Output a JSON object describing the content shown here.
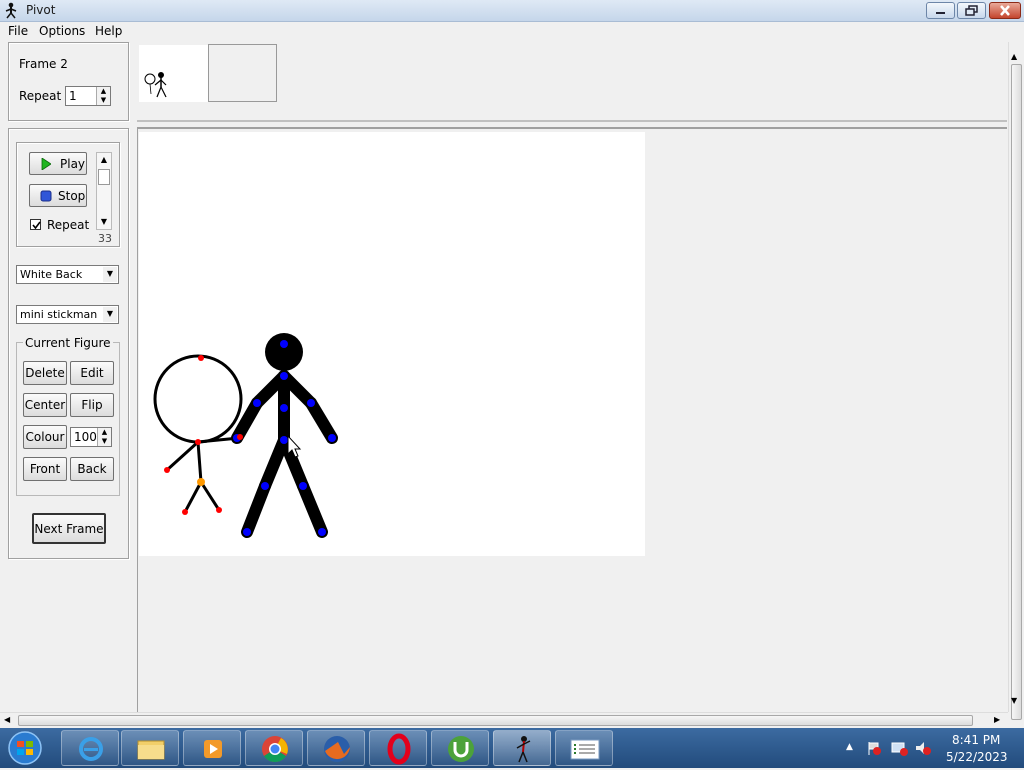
{
  "window": {
    "title": "Pivot"
  },
  "menu": [
    "File",
    "Options",
    "Help"
  ],
  "frame_panel": {
    "frame_label": "Frame 2",
    "repeat_label": "Repeat :",
    "repeat_value": "1"
  },
  "playback": {
    "play_label": "Play",
    "stop_label": "Stop",
    "repeat_label": "Repeat",
    "repeat_checked": true,
    "speed_value": "33"
  },
  "background_select": {
    "value": "White Back"
  },
  "figure_select": {
    "value": "mini stickman"
  },
  "current_figure": {
    "title": "Current Figure",
    "delete_label": "Delete",
    "edit_label": "Edit",
    "center_label": "Center",
    "flip_label": "Flip",
    "colour_label": "Colour",
    "colour_value": "100",
    "front_label": "Front",
    "back_label": "Back"
  },
  "next_frame_label": "Next Frame",
  "taskbar": {
    "apps": [
      "start-orb",
      "internet-explorer-icon",
      "file-explorer-icon",
      "media-player-icon",
      "chrome-icon",
      "firefox-icon",
      "opera-icon",
      "utorrent-icon",
      "pivot-icon",
      "notepad-icon"
    ],
    "time": "8:41 PM",
    "date": "5/22/2023"
  },
  "colors": {
    "joint_main": "#0000ff",
    "joint_mini": "#ff0000",
    "joint_mini_center": "#ff9900",
    "figure": "#000000"
  }
}
